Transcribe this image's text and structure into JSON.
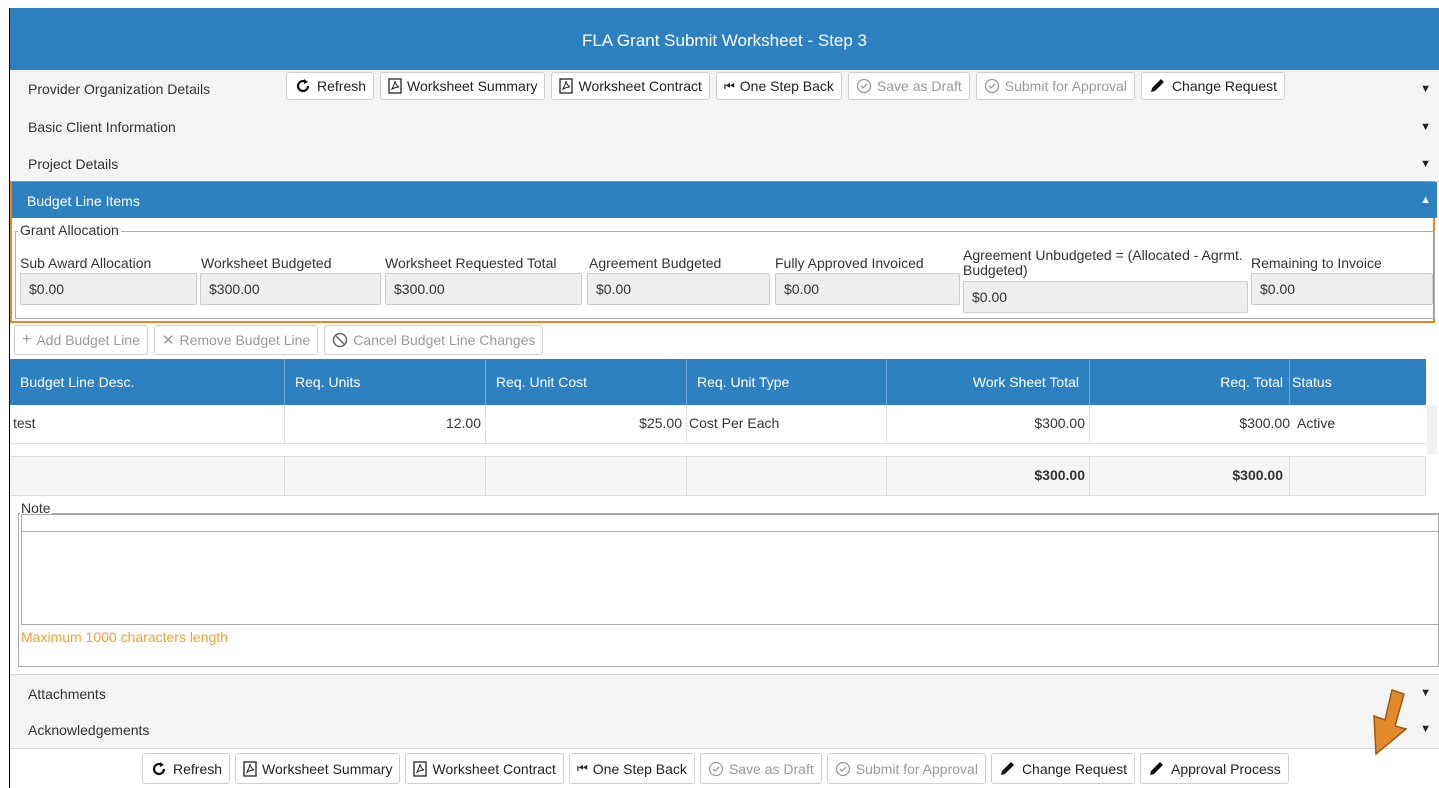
{
  "window": {
    "title": "FLA Grant Submit Worksheet - Step 3"
  },
  "sections": {
    "provider": "Provider Organization Details",
    "basic_client": "Basic Client Information",
    "project": "Project Details",
    "budget": "Budget Line Items",
    "attachments": "Attachments",
    "acknowledgements": "Acknowledgements"
  },
  "top_toolbar": {
    "refresh": "Refresh",
    "worksheet_summary": "Worksheet Summary",
    "worksheet_contract": "Worksheet Contract",
    "one_step_back": "One Step Back",
    "save_as_draft": "Save as Draft",
    "submit_for_approval": "Submit for Approval",
    "change_request": "Change Request"
  },
  "grant_allocation": {
    "legend": "Grant Allocation",
    "fields": [
      {
        "label": "Sub Award Allocation",
        "value": "$0.00"
      },
      {
        "label": "Worksheet Budgeted",
        "value": "$300.00"
      },
      {
        "label": "Worksheet Requested Total",
        "value": "$300.00"
      },
      {
        "label": "Agreement Budgeted",
        "value": "$0.00"
      },
      {
        "label": "Fully Approved Invoiced",
        "value": "$0.00"
      },
      {
        "label": "Agreement Unbudgeted = (Allocated - Agrmt. Budgeted)",
        "value": "$0.00"
      },
      {
        "label": "Remaining to Invoice",
        "value": "$0.00"
      }
    ]
  },
  "budget_toolbar": {
    "add": "Add Budget Line",
    "remove": "Remove Budget Line",
    "cancel": "Cancel Budget Line Changes"
  },
  "grid": {
    "columns": [
      "Budget Line Desc.",
      "Req. Units",
      "Req. Unit Cost",
      "Req. Unit Type",
      "Work Sheet Total",
      "Req. Total",
      "Status"
    ],
    "rows": [
      {
        "desc": "test",
        "units": "12.00",
        "unit_cost": "$25.00",
        "unit_type": "Cost Per Each",
        "ws_total": "$300.00",
        "req_total": "$300.00",
        "status": "Active"
      }
    ],
    "totals": {
      "ws_total": "$300.00",
      "req_total": "$300.00"
    }
  },
  "note": {
    "legend": "Note",
    "value": "",
    "max_length_text": "Maximum 1000 characters length"
  },
  "bottom_toolbar": {
    "refresh": "Refresh",
    "worksheet_summary": "Worksheet Summary",
    "worksheet_contract": "Worksheet Contract",
    "one_step_back": "One Step Back",
    "save_as_draft": "Save as Draft",
    "submit_for_approval": "Submit for Approval",
    "change_request": "Change Request",
    "approval_process": "Approval Process"
  },
  "colors": {
    "header_blue": "#2e81c1",
    "highlight_orange": "#e68a1f",
    "hint_orange": "#f0a030"
  }
}
